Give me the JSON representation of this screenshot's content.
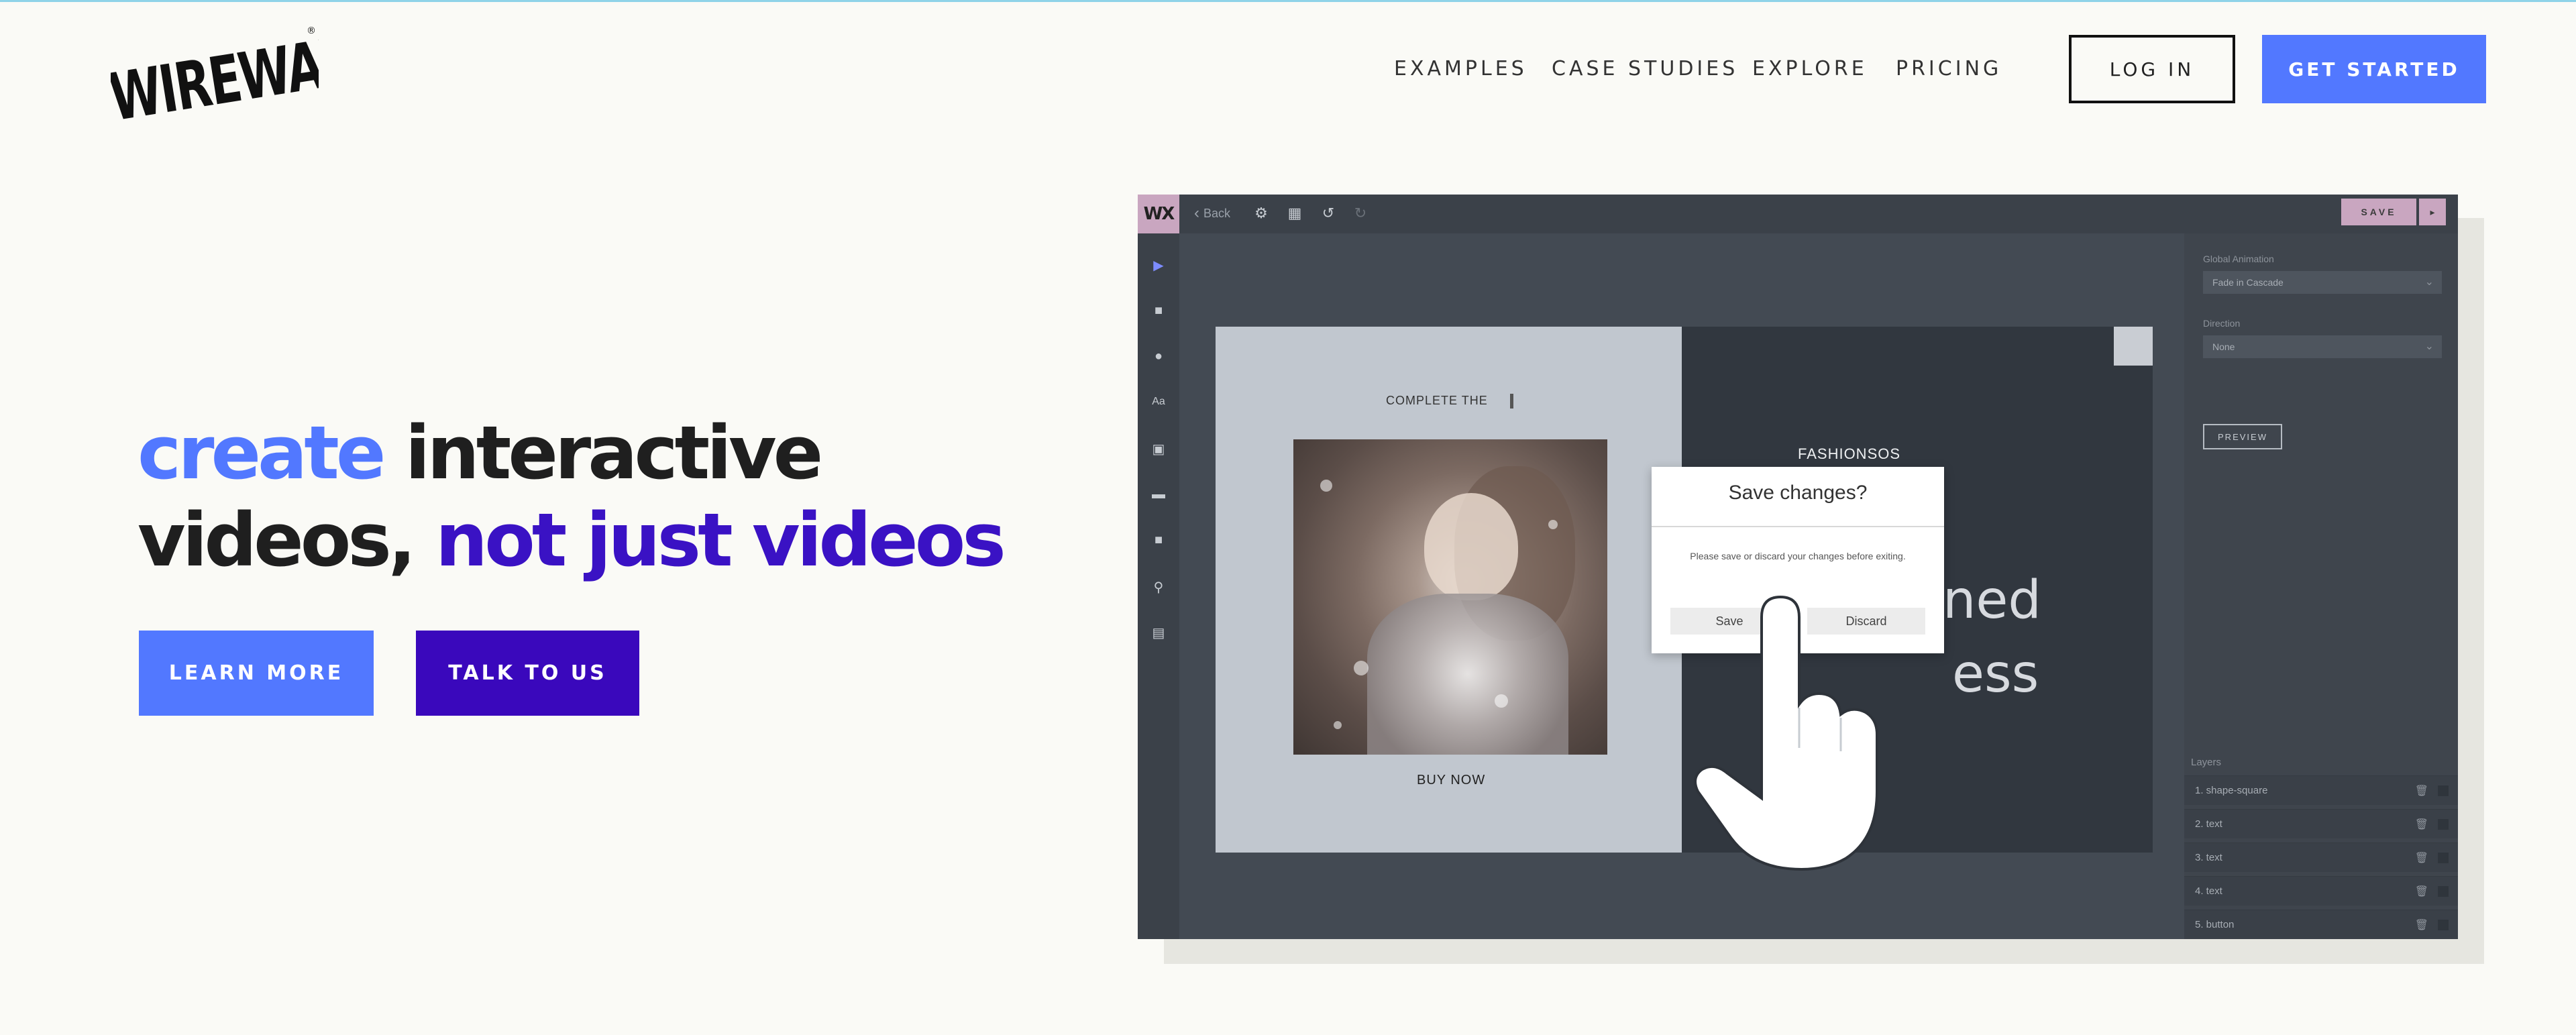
{
  "brand": {
    "logo_text": "WIREWAX"
  },
  "nav": {
    "links": [
      "EXAMPLES",
      "CASE STUDIES",
      "EXPLORE",
      "PRICING"
    ],
    "login_label": "LOG IN",
    "get_started_label": "GET STARTED"
  },
  "hero": {
    "line1_highlight": "create",
    "line1_rest": "interactive",
    "line2_start": "videos,",
    "line2_highlight": "not just videos",
    "learn_more_label": "LEARN MORE",
    "talk_to_us_label": "TALK TO US"
  },
  "colors": {
    "accent_blue": "#5278ff",
    "accent_purple": "#3a08bc",
    "editor_bg": "#434a53",
    "editor_pink": "#c9a6c0"
  },
  "editor": {
    "logo": "WX",
    "back_label": "Back",
    "save_label": "SAVE",
    "toolbar_icons": [
      "settings-icon",
      "grid-icon",
      "undo-icon",
      "redo-icon"
    ],
    "tools": [
      "cursor-tool-icon",
      "square-tool-icon",
      "circle-tool-icon",
      "text-tool-icon",
      "image-tool-icon",
      "button-tool-icon",
      "video-tool-icon",
      "location-tool-icon",
      "card-tool-icon"
    ],
    "text_tool_label": "Aa",
    "panel": {
      "global_animation_label": "Global Animation",
      "global_animation_value": "Fade in Cascade",
      "direction_label": "Direction",
      "direction_value": "None",
      "preview_label": "PREVIEW",
      "layers_title": "Layers",
      "layers": [
        "1.  shape-square",
        "2.  text",
        "3.  text",
        "4.  text",
        "5.  button"
      ]
    },
    "canvas": {
      "complete_text": "COMPLETE THE",
      "buy_now": "BUY NOW",
      "brand_text": "FASHIONSOS",
      "big_text_1": "ned",
      "big_text_2": "ess"
    },
    "dialog": {
      "title": "Save changes?",
      "message": "Please save or discard your changes before exiting.",
      "save_label": "Save",
      "discard_label": "Discard"
    }
  }
}
